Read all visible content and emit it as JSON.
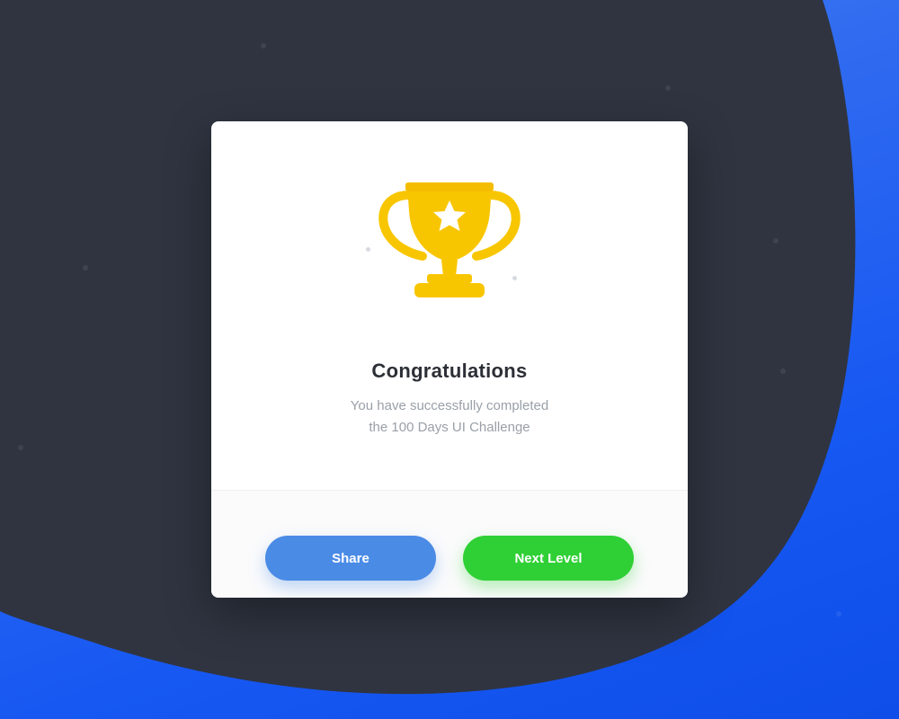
{
  "dialog": {
    "title": "Congratulations",
    "message_line1": "You have successfully completed",
    "message_line2": "the 100 Days UI Challenge",
    "icon": "trophy-icon",
    "share_label": "Share",
    "next_label": "Next Level"
  },
  "colors": {
    "dark_background": "#2f3440",
    "blue_background": "#1758f2",
    "trophy": "#f8c600",
    "share_button": "#4a8be6",
    "next_button": "#2fd035"
  }
}
